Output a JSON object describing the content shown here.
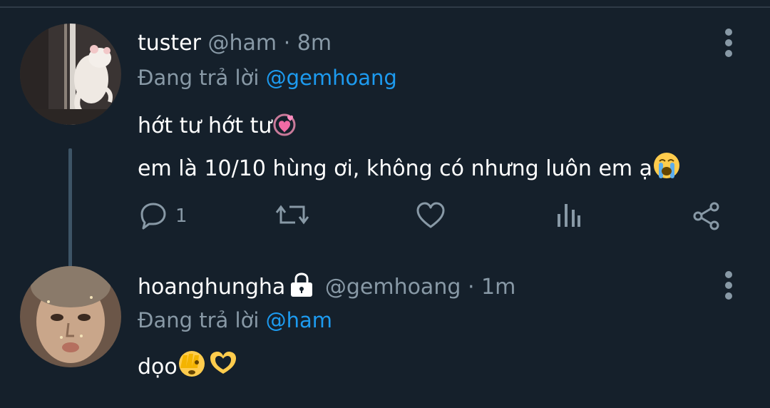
{
  "tweets": [
    {
      "name": "tuster",
      "handle": "@ham",
      "separator": "·",
      "time": "8m",
      "reply_prefix": "Đang trả lời",
      "reply_to": "@gemhoang",
      "body_lines": [
        "hớt tư hớt tư",
        "em là 10/10 hùng ơi, không có nhưng luôn em ạ"
      ],
      "body_emojis": [
        "revolving-hearts-emoji",
        "loudly-crying-face-emoji"
      ],
      "reply_count": "1"
    },
    {
      "name": "hoanghungha",
      "protected": true,
      "handle": "@gemhoang",
      "separator": "·",
      "time": "1m",
      "reply_prefix": "Đang trả lời",
      "reply_to": "@ham",
      "body": "dọo",
      "body_emojis": [
        "face-with-peeking-eye-emoji",
        "heart-hands-emoji"
      ]
    }
  ],
  "icons": {
    "reply": "reply-icon",
    "retweet": "retweet-icon",
    "like": "heart-icon",
    "views": "views-chart-icon",
    "share": "share-icon",
    "more": "more-vertical-icon",
    "lock": "lock-icon"
  },
  "colors": {
    "background": "#15202b",
    "muted": "#8899a6",
    "link": "#1d9bf0",
    "thread_line": "#3d5466"
  }
}
